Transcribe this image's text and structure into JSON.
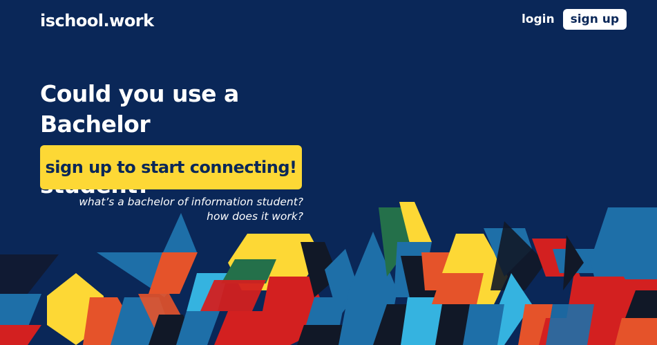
{
  "header": {
    "logo": "ischool.work",
    "login_label": "login",
    "signup_label": "sign up"
  },
  "hero": {
    "headline_line1": "Could you use a Bachelor",
    "headline_line2": "of Information student?",
    "cta_label": "sign up to start connecting!",
    "link_what": "what’s a bachelor of information student?",
    "link_how": "how does it work?"
  },
  "colors": {
    "background": "#0a2758",
    "cta": "#fdd835",
    "pattern_yellow": "#fdd835",
    "pattern_red": "#d32020",
    "pattern_blue": "#1e6fa8",
    "pattern_cyan": "#35b3e0",
    "pattern_green": "#24704a",
    "pattern_black": "#111827",
    "pattern_orange": "#e5532a"
  }
}
